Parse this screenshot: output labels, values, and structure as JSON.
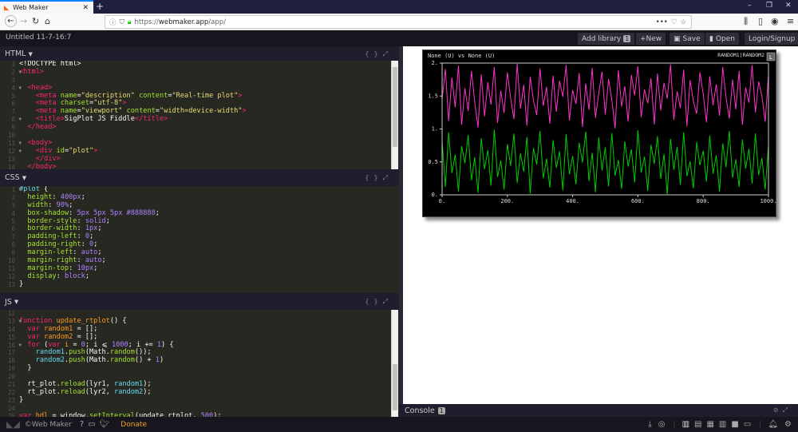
{
  "browser": {
    "tab_title": "Web Maker",
    "url_prefix": "https://",
    "url_domain": "webmaker.app",
    "url_path": "/app/"
  },
  "app": {
    "doc_title": "Untitled 11-7-16:7",
    "add_library": "Add library",
    "library_count": "1",
    "new": "+New",
    "save": "Save",
    "open": "Open",
    "login": "Login/Signup"
  },
  "panels": {
    "html": {
      "title": "HTML",
      "start": 1,
      "folds": [
        2,
        4,
        8,
        11,
        12
      ],
      "lines": [
        [
          [
            "def",
            "<!DOCTYPE html>"
          ]
        ],
        [
          [
            "tag",
            "<html>"
          ]
        ],
        [],
        [
          [
            "def",
            "  "
          ],
          [
            "tag",
            "<head>"
          ]
        ],
        [
          [
            "def",
            "    "
          ],
          [
            "tag",
            "<meta "
          ],
          [
            "attr",
            "name"
          ],
          [
            "def",
            "="
          ],
          [
            "str",
            "\"description\""
          ],
          [
            "def",
            " "
          ],
          [
            "attr",
            "content"
          ],
          [
            "def",
            "="
          ],
          [
            "str",
            "\"Real-time plot\""
          ],
          [
            "tag",
            ">"
          ]
        ],
        [
          [
            "def",
            "    "
          ],
          [
            "tag",
            "<meta "
          ],
          [
            "attr",
            "charset"
          ],
          [
            "def",
            "="
          ],
          [
            "str",
            "\"utf-8\""
          ],
          [
            "tag",
            ">"
          ]
        ],
        [
          [
            "def",
            "    "
          ],
          [
            "tag",
            "<meta "
          ],
          [
            "attr",
            "name"
          ],
          [
            "def",
            "="
          ],
          [
            "str",
            "\"viewport\""
          ],
          [
            "def",
            " "
          ],
          [
            "attr",
            "content"
          ],
          [
            "def",
            "="
          ],
          [
            "str",
            "\"width=device-width\""
          ],
          [
            "tag",
            ">"
          ]
        ],
        [
          [
            "def",
            "    "
          ],
          [
            "tag",
            "<title>"
          ],
          [
            "def",
            "SigPlot JS Fiddle"
          ],
          [
            "tag",
            "</title>"
          ]
        ],
        [
          [
            "def",
            "  "
          ],
          [
            "tag",
            "</head>"
          ]
        ],
        [],
        [
          [
            "def",
            "  "
          ],
          [
            "tag",
            "<body>"
          ]
        ],
        [
          [
            "def",
            "    "
          ],
          [
            "tag",
            "<div "
          ],
          [
            "attr",
            "id"
          ],
          [
            "def",
            "="
          ],
          [
            "str",
            "\"plot\""
          ],
          [
            "tag",
            ">"
          ]
        ],
        [
          [
            "def",
            "    "
          ],
          [
            "tag",
            "</div>"
          ]
        ],
        [
          [
            "def",
            "  "
          ],
          [
            "tag",
            "</body>"
          ]
        ]
      ]
    },
    "css": {
      "title": "CSS",
      "start": 1,
      "folds": [
        1
      ],
      "lines": [
        [
          [
            "sel",
            "#plot"
          ],
          [
            "def",
            " {"
          ]
        ],
        [
          [
            "def",
            "  "
          ],
          [
            "prop",
            "height"
          ],
          [
            "def",
            ": "
          ],
          [
            "num",
            "400px"
          ],
          [
            "def",
            ";"
          ]
        ],
        [
          [
            "def",
            "  "
          ],
          [
            "prop",
            "width"
          ],
          [
            "def",
            ": "
          ],
          [
            "num",
            "90%"
          ],
          [
            "def",
            ";"
          ]
        ],
        [
          [
            "def",
            "  "
          ],
          [
            "prop",
            "box-shadow"
          ],
          [
            "def",
            ": "
          ],
          [
            "num",
            "5px 5px 5px #888888"
          ],
          [
            "def",
            ";"
          ]
        ],
        [
          [
            "def",
            "  "
          ],
          [
            "prop",
            "border-style"
          ],
          [
            "def",
            ": "
          ],
          [
            "num",
            "solid"
          ],
          [
            "def",
            ";"
          ]
        ],
        [
          [
            "def",
            "  "
          ],
          [
            "prop",
            "border-width"
          ],
          [
            "def",
            ": "
          ],
          [
            "num",
            "1px"
          ],
          [
            "def",
            ";"
          ]
        ],
        [
          [
            "def",
            "  "
          ],
          [
            "prop",
            "padding-left"
          ],
          [
            "def",
            ": "
          ],
          [
            "num",
            "0"
          ],
          [
            "def",
            ";"
          ]
        ],
        [
          [
            "def",
            "  "
          ],
          [
            "prop",
            "padding-right"
          ],
          [
            "def",
            ": "
          ],
          [
            "num",
            "0"
          ],
          [
            "def",
            ";"
          ]
        ],
        [
          [
            "def",
            "  "
          ],
          [
            "prop",
            "margin-left"
          ],
          [
            "def",
            ": "
          ],
          [
            "num",
            "auto"
          ],
          [
            "def",
            ";"
          ]
        ],
        [
          [
            "def",
            "  "
          ],
          [
            "prop",
            "margin-right"
          ],
          [
            "def",
            ": "
          ],
          [
            "num",
            "auto"
          ],
          [
            "def",
            ";"
          ]
        ],
        [
          [
            "def",
            "  "
          ],
          [
            "prop",
            "margin-top"
          ],
          [
            "def",
            ": "
          ],
          [
            "num",
            "10px"
          ],
          [
            "def",
            ";"
          ]
        ],
        [
          [
            "def",
            "  "
          ],
          [
            "prop",
            "display"
          ],
          [
            "def",
            ": "
          ],
          [
            "num",
            "block"
          ],
          [
            "def",
            ";"
          ]
        ],
        [
          [
            "def",
            "}"
          ]
        ]
      ]
    },
    "js": {
      "title": "JS",
      "start": 12,
      "folds": [
        13,
        16
      ],
      "lines": [
        [],
        [
          [
            "kw",
            "function "
          ],
          [
            "var",
            "update_rtplot"
          ],
          [
            "def",
            "() {"
          ]
        ],
        [
          [
            "def",
            "  "
          ],
          [
            "kw",
            "var "
          ],
          [
            "var",
            "random1"
          ],
          [
            "def",
            " = [];"
          ]
        ],
        [
          [
            "def",
            "  "
          ],
          [
            "kw",
            "var "
          ],
          [
            "var",
            "random2"
          ],
          [
            "def",
            " = [];"
          ]
        ],
        [
          [
            "def",
            "  "
          ],
          [
            "kw",
            "for "
          ],
          [
            "def",
            "("
          ],
          [
            "kw",
            "var "
          ],
          [
            "var",
            "i"
          ],
          [
            "def",
            " = "
          ],
          [
            "num",
            "0"
          ],
          [
            "def",
            "; i ⩽ "
          ],
          [
            "num",
            "1000"
          ],
          [
            "def",
            "; i += "
          ],
          [
            "num",
            "1"
          ],
          [
            "def",
            ") {"
          ]
        ],
        [
          [
            "def",
            "    "
          ],
          [
            "bi",
            "random1"
          ],
          [
            "def",
            "."
          ],
          [
            "fn",
            "push"
          ],
          [
            "def",
            "(Math."
          ],
          [
            "fn",
            "random"
          ],
          [
            "def",
            "());"
          ]
        ],
        [
          [
            "def",
            "    "
          ],
          [
            "bi",
            "random2"
          ],
          [
            "def",
            "."
          ],
          [
            "fn",
            "push"
          ],
          [
            "def",
            "(Math."
          ],
          [
            "fn",
            "random"
          ],
          [
            "def",
            "() + "
          ],
          [
            "num",
            "1"
          ],
          [
            "def",
            ")"
          ]
        ],
        [
          [
            "def",
            "  }"
          ]
        ],
        [],
        [
          [
            "def",
            "  rt_plot."
          ],
          [
            "fn",
            "reload"
          ],
          [
            "def",
            "(lyr1, "
          ],
          [
            "bi",
            "random1"
          ],
          [
            "def",
            ");"
          ]
        ],
        [
          [
            "def",
            "  rt_plot."
          ],
          [
            "fn",
            "reload"
          ],
          [
            "def",
            "(lyr2, "
          ],
          [
            "bi",
            "random2"
          ],
          [
            "def",
            ");"
          ]
        ],
        [
          [
            "def",
            "}"
          ]
        ],
        [],
        [
          [
            "kw",
            "var "
          ],
          [
            "var",
            "hdl"
          ],
          [
            "def",
            " = window."
          ],
          [
            "fn",
            "setInterval"
          ],
          [
            "def",
            "(update_rtplot, "
          ],
          [
            "num",
            "500"
          ],
          [
            "def",
            ");"
          ]
        ]
      ]
    }
  },
  "console": {
    "label": "Console",
    "count": "1"
  },
  "footer": {
    "brand": "©Web Maker",
    "donate": "Donate"
  },
  "chart_data": {
    "type": "line",
    "title": "None (U) vs None (U)",
    "legend": "RANDOM1|RANDOM2",
    "legend_button": "L",
    "xlim": [
      0,
      1000
    ],
    "ylim": [
      0,
      2
    ],
    "xticks": [
      "0.",
      "200.",
      "400.",
      "600.",
      "800.",
      "1000."
    ],
    "yticks": [
      "0.",
      "0.5",
      "1.",
      "1.5",
      "2."
    ],
    "series": [
      {
        "name": "RANDOM1",
        "color": "#00cc00",
        "values": [
          0.82,
          0.12,
          0.95,
          0.33,
          0.61,
          0.05,
          0.74,
          0.48,
          0.91,
          0.22,
          0.57,
          0.03,
          0.86,
          0.39,
          0.68,
          0.14,
          0.99,
          0.27,
          0.52,
          0.08,
          0.77,
          0.44,
          0.93,
          0.18,
          0.63,
          0.35,
          0.88,
          0.02,
          0.71,
          0.46,
          0.97,
          0.25,
          0.55,
          0.11,
          0.83,
          0.41,
          0.66,
          0.07,
          0.92,
          0.31,
          0.59,
          0.16,
          0.79,
          0.49,
          0.96,
          0.21,
          0.64,
          0.04,
          0.87,
          0.37,
          0.72,
          0.13,
          0.94,
          0.29,
          0.53,
          0.09,
          0.81,
          0.43,
          0.69,
          0.19,
          0.98,
          0.34,
          0.58,
          0.06,
          0.76,
          0.47,
          0.89,
          0.24,
          0.62,
          0.01,
          0.85,
          0.38,
          0.73,
          0.15,
          0.95,
          0.28,
          0.51,
          0.1,
          0.8,
          0.45,
          0.67,
          0.2,
          0.9,
          0.32,
          0.6,
          0.05,
          0.78,
          0.42,
          0.97,
          0.26,
          0.54,
          0.12,
          0.84,
          0.4,
          0.7,
          0.17,
          0.93,
          0.3,
          0.56,
          0.08,
          0.75
        ]
      },
      {
        "name": "RANDOM2",
        "color": "#ff33cc",
        "values": [
          1.45,
          1.91,
          1.12,
          1.78,
          1.33,
          1.96,
          1.06,
          1.62,
          1.27,
          1.88,
          1.41,
          1.02,
          1.83,
          1.19,
          1.71,
          1.37,
          1.94,
          1.09,
          1.58,
          1.24,
          1.86,
          1.47,
          1.15,
          1.99,
          1.31,
          1.67,
          1.05,
          1.79,
          1.43,
          1.21,
          1.92,
          1.35,
          1.64,
          1.08,
          1.81,
          1.26,
          1.73,
          1.49,
          1.97,
          1.13,
          1.59,
          1.38,
          1.85,
          1.03,
          1.69,
          1.29,
          1.93,
          1.17,
          1.54,
          1.87,
          1.22,
          1.76,
          1.44,
          1.01,
          1.89,
          1.34,
          1.65,
          1.11,
          1.82,
          1.51,
          1.95,
          1.18,
          1.6,
          1.39,
          1.77,
          1.07,
          1.84,
          1.28,
          1.7,
          1.46,
          1.98,
          1.14,
          1.57,
          1.32,
          1.9,
          1.04,
          1.74,
          1.42,
          1.23,
          1.86,
          1.53,
          1.1,
          1.8,
          1.36,
          1.68,
          1.2,
          1.94,
          1.48,
          1.16,
          1.75,
          1.3,
          1.88,
          1.06,
          1.63,
          1.4,
          1.97,
          1.25,
          1.72,
          1.5,
          1.11,
          1.83
        ]
      }
    ]
  }
}
